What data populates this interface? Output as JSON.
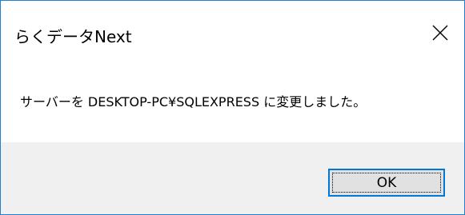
{
  "window": {
    "title": "らくデータNext"
  },
  "titlebar": {
    "close_icon": "close-icon"
  },
  "content": {
    "message": "サーバーを DESKTOP-PC¥SQLEXPRESS に変更しました。"
  },
  "footer": {
    "ok_label": "OK"
  },
  "colors": {
    "window_border": "#1f7fd1",
    "footer_background": "#f0f0f0",
    "button_border": "#0078d7",
    "button_background": "#e1e1e1"
  }
}
